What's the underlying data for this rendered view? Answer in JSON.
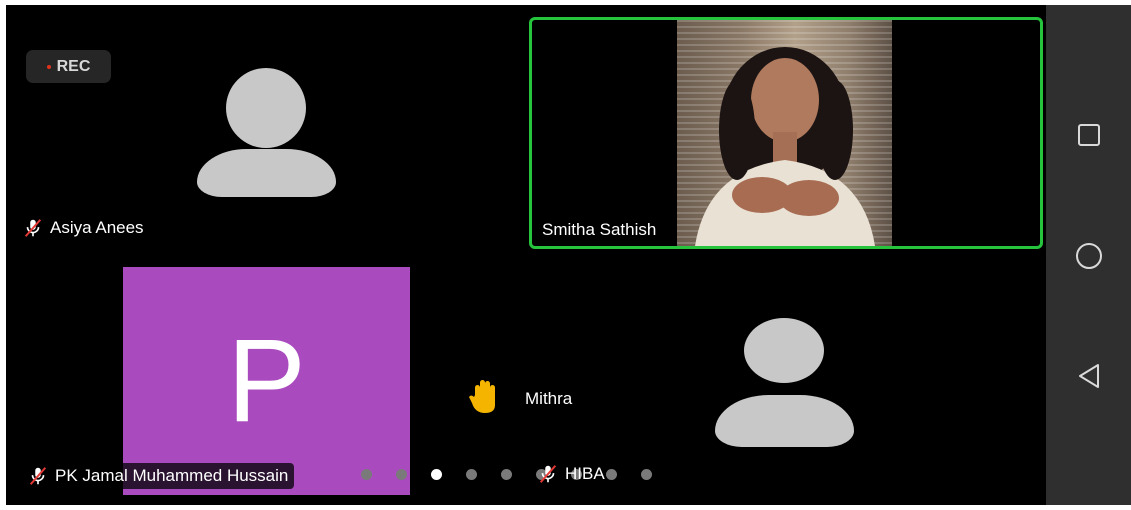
{
  "recording": {
    "label": "REC"
  },
  "participants": {
    "asiya": {
      "name": "Asiya Anees"
    },
    "active_speaker": {
      "name": "Smitha Sathish"
    },
    "pk": {
      "initial": "P",
      "name": "PK Jamal Muhammed Hussain"
    },
    "mithra": {
      "name": "Mithra"
    },
    "hiba": {
      "name": "HIBA"
    }
  },
  "pager": {
    "total": 9,
    "current": 3
  },
  "colors": {
    "background": "#000000",
    "active_border": "#25c43c",
    "initial_tile": "#a94bbf",
    "avatar": "#c8c8c8",
    "navbar": "#2f2f2f",
    "raised_hand": "#f5b400"
  },
  "icons": {
    "mic_muted": "mic-muted-icon",
    "raised_hand": "raised-hand-icon",
    "nav": [
      "square-icon",
      "circle-icon",
      "triangle-back-icon"
    ]
  }
}
